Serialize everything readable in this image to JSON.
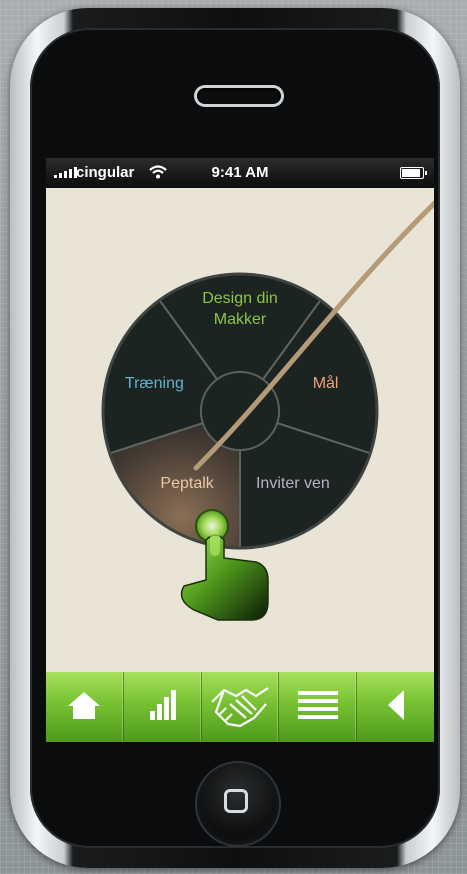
{
  "status_bar": {
    "carrier": "cingular",
    "time": "9:41 AM",
    "battery_level": 0.9
  },
  "wheel": {
    "segments": [
      {
        "id": "design",
        "lines": [
          "Design din",
          "Makker"
        ],
        "color": "#8cc63f"
      },
      {
        "id": "maal",
        "lines": [
          "Mål"
        ],
        "color": "#f0a07a"
      },
      {
        "id": "inviter",
        "lines": [
          "Inviter ven"
        ],
        "color": "#b9b0c8"
      },
      {
        "id": "peptalk",
        "lines": [
          "Peptalk"
        ],
        "color": "#e8c9a6",
        "active": true
      },
      {
        "id": "traening",
        "lines": [
          "Træning"
        ],
        "color": "#5fb3cf"
      }
    ],
    "background": "#1c2422",
    "active_background": "#6b5a4a"
  },
  "tabbar": {
    "items": [
      {
        "icon": "home-icon"
      },
      {
        "icon": "stats-icon"
      },
      {
        "icon": "handshake-icon"
      },
      {
        "icon": "menu-icon"
      },
      {
        "icon": "back-icon"
      }
    ],
    "color": "#76c132"
  }
}
